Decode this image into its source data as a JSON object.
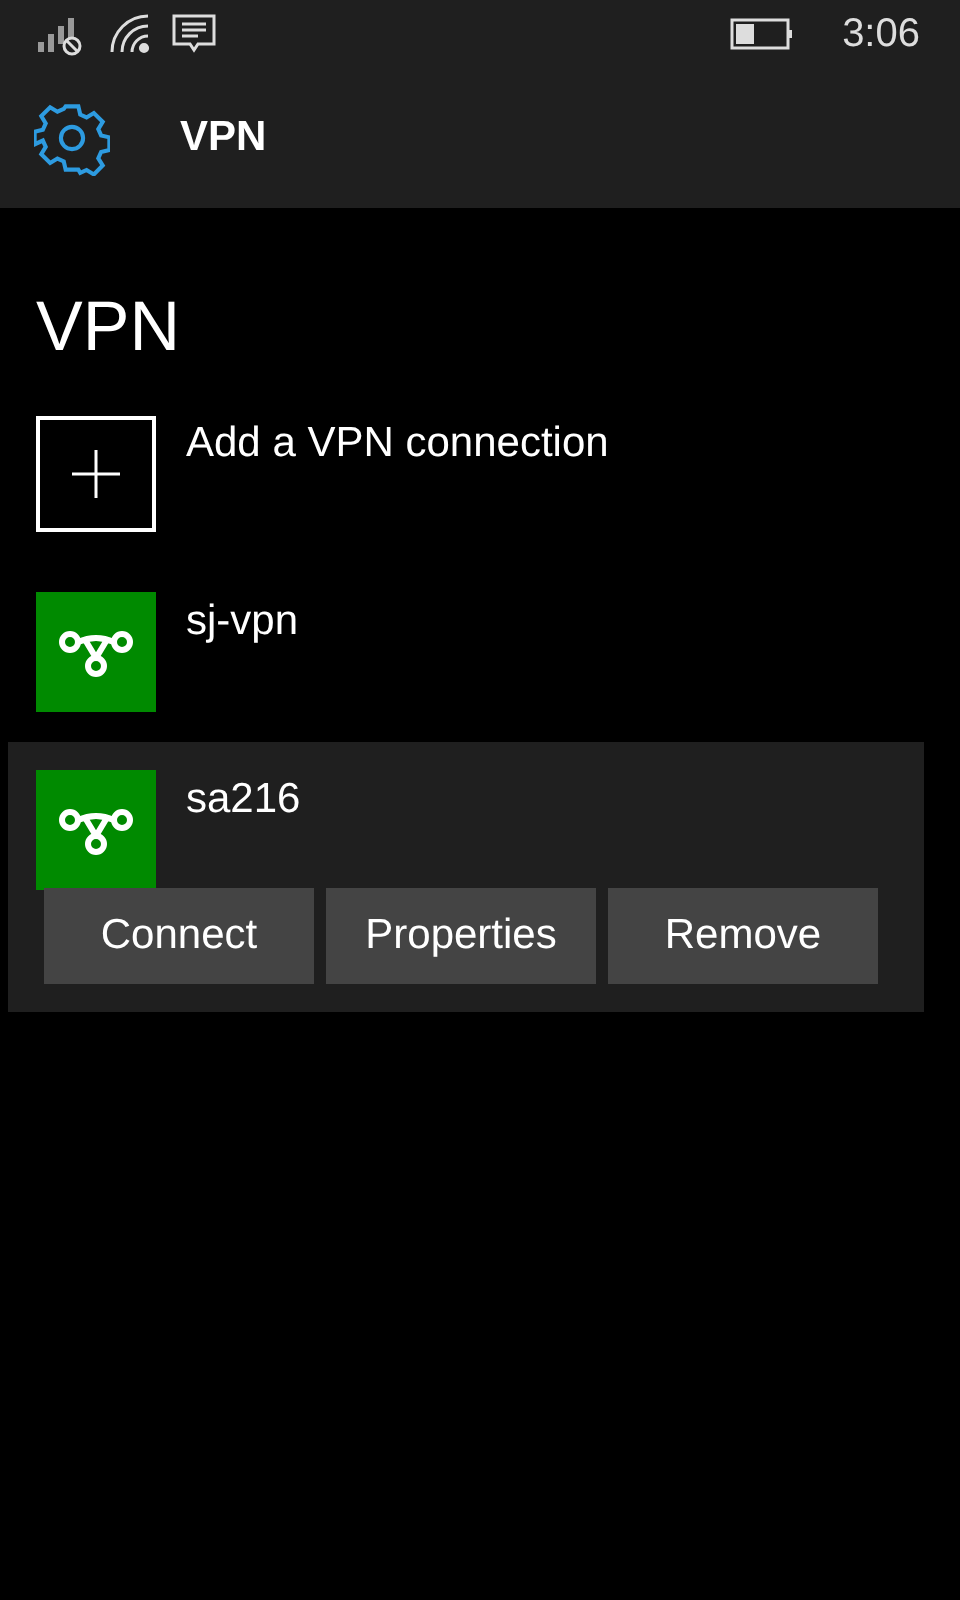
{
  "status_bar": {
    "time": "3:06"
  },
  "header": {
    "title": "VPN"
  },
  "page_title": "VPN",
  "add_item": {
    "label": "Add a VPN connection"
  },
  "connections": [
    {
      "name": "sj-vpn",
      "expanded": false
    },
    {
      "name": "sa216",
      "expanded": true,
      "actions": [
        "Connect",
        "Properties",
        "Remove"
      ]
    }
  ]
}
